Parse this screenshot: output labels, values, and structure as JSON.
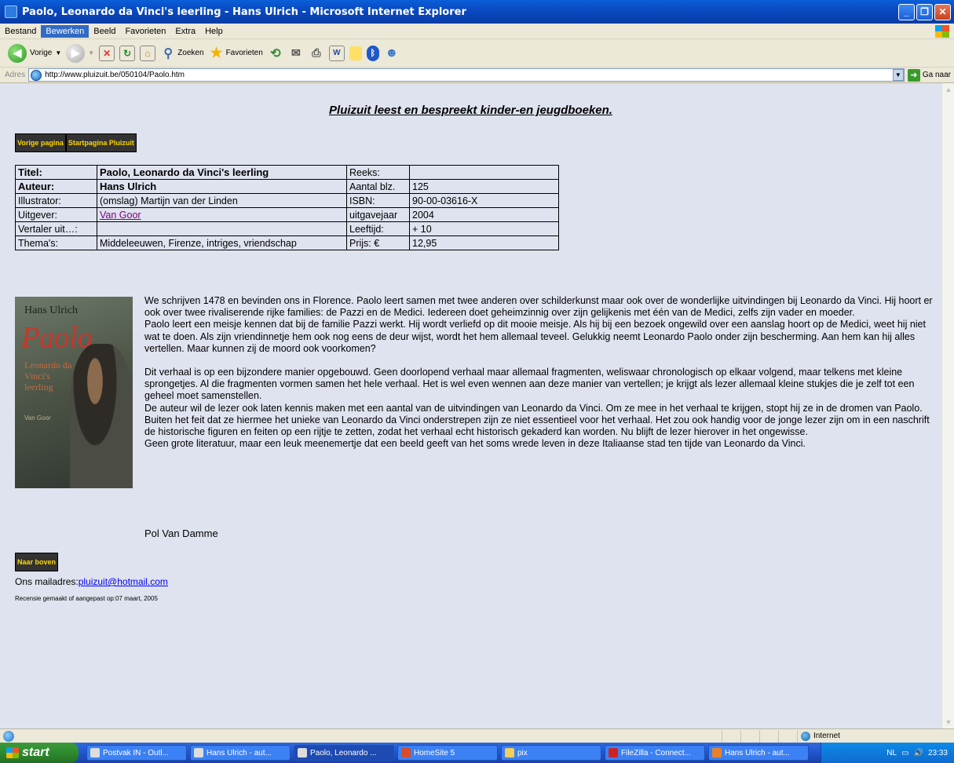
{
  "window": {
    "title": "Paolo, Leonardo da Vinci's leerling - Hans Ulrich - Microsoft Internet Explorer"
  },
  "menu": [
    "Bestand",
    "Bewerken",
    "Beeld",
    "Favorieten",
    "Extra",
    "Help"
  ],
  "menu_active_index": 1,
  "toolbar": {
    "back": "Vorige",
    "search": "Zoeken",
    "favorites": "Favorieten"
  },
  "address": {
    "label": "Adres",
    "url": "http://www.pluizuit.be/050104/Paolo.htm",
    "go": "Ga naar"
  },
  "page": {
    "site_title": "Pluizuit leest en bespreekt kinder-en jeugdboeken.",
    "nav": {
      "prev": "Vorige pagina",
      "home": "Startpagina Pluizuit"
    },
    "info_table": [
      [
        "Titel:",
        "Paolo, Leonardo da Vinci's leerling",
        "Reeks:",
        ""
      ],
      [
        "Auteur:",
        "Hans Ulrich",
        "Aantal blz.",
        "125"
      ],
      [
        "Illustrator:",
        "(omslag) Martijn van der Linden",
        "ISBN:",
        "90-00-03616-X"
      ],
      [
        "Uitgever:",
        "Van Goor",
        "uitgavejaar",
        "2004"
      ],
      [
        "Vertaler uit…:",
        "",
        "Leeftijd:",
        "+ 10"
      ],
      [
        "Thema's:",
        "Middeleeuwen, Firenze, intriges, vriendschap",
        "Prijs: €",
        "12,95"
      ]
    ],
    "cover": {
      "author": "Hans Ulrich",
      "title": "Paolo",
      "subtitle": "Leonardo da Vinci's leerling",
      "publisher": "Van Goor"
    },
    "review": {
      "p1": "We schrijven 1478 en bevinden ons in Florence. Paolo leert samen met twee anderen over schilderkunst maar ook over de wonderlijke uitvindingen bij Leonardo da Vinci. Hij hoort er ook over twee rivaliserende rijke families: de Pazzi en de Medici. Iedereen doet geheimzinnig over zijn gelijkenis met één van de Medici, zelfs zijn vader en moeder.",
      "p2": "Paolo leert een meisje kennen dat bij de familie Pazzi werkt. Hij wordt verliefd op dit mooie meisje. Als hij bij een bezoek ongewild over een aanslag hoort op de Medici, weet hij niet wat te doen. Als zijn vriendinnetje hem ook nog eens de deur wijst, wordt het hem allemaal teveel. Gelukkig neemt Leonardo Paolo onder zijn bescherming. Aan hem kan hij alles vertellen. Maar kunnen zij de moord ook voorkomen?",
      "p3": "Dit verhaal is op een bijzondere manier opgebouwd. Geen doorlopend verhaal maar allemaal fragmenten, weliswaar chronologisch op elkaar volgend, maar telkens met kleine sprongetjes. Al die fragmenten vormen samen het hele verhaal. Het is wel even wennen aan deze manier van vertellen; je krijgt als lezer allemaal kleine stukjes die je zelf tot een geheel moet samenstellen.",
      "p4": "De auteur wil de lezer ook laten kennis maken met een aantal van de uitvindingen van Leonardo da Vinci. Om ze mee in het verhaal te krijgen, stopt hij ze in de dromen van Paolo. Buiten het feit dat ze hiermee het unieke van Leonardo da Vinci onderstrepen zijn ze niet essentieel voor het verhaal. Het zou ook handig voor de jonge lezer zijn om in een naschrift de historische figuren en feiten op een rijtje te zetten, zodat het verhaal echt historisch gekaderd kan worden. Nu blijft de lezer hierover in het ongewisse.",
      "p5": "Geen grote literatuur, maar een leuk meenemertje dat een beeld geeft van het soms wrede leven in deze Italiaanse stad ten tijde van Leonardo da Vinci."
    },
    "signature": "Pol Van Damme",
    "top_button": "Naar boven",
    "mail_label": "Ons mailadres:",
    "mail": "pluizuit@hotmail.com",
    "revised": "Recensie gemaakt of aangepast op:07 maart, 2005"
  },
  "statusbar": {
    "zone": "Internet"
  },
  "taskbar": {
    "start": "start",
    "tasks": [
      "Postvak IN - Outl...",
      "Hans Ulrich - aut...",
      "Paolo, Leonardo ...",
      "HomeSite 5",
      "pix",
      "FileZilla - Connect...",
      "Hans Ulrich - aut..."
    ],
    "active_task": 2,
    "lang": "NL",
    "time": "23:33"
  }
}
